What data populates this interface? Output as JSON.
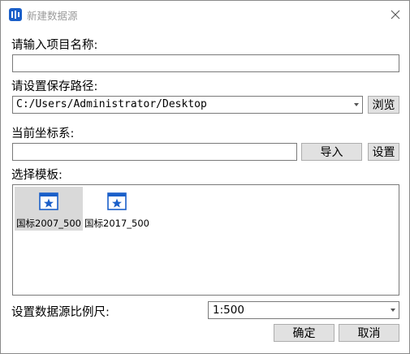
{
  "window": {
    "title": "新建数据源",
    "icon": "app-logo-icon",
    "close_icon": "close-icon"
  },
  "project_name": {
    "label": "请输入项目名称:",
    "value": ""
  },
  "save_path": {
    "label": "请设置保存路径:",
    "value": "C:/Users/Administrator/Desktop",
    "browse_label": "浏览"
  },
  "coordinate_system": {
    "label": "当前坐标系:",
    "value": "",
    "import_label": "导入",
    "settings_label": "设置"
  },
  "templates": {
    "label": "选择模板:",
    "items": [
      {
        "label": "国标2007_500",
        "selected": true,
        "icon": "template-icon"
      },
      {
        "label": "国标2017_500",
        "selected": false,
        "icon": "template-icon"
      }
    ]
  },
  "scale": {
    "label": "设置数据源比例尺:",
    "value": "1:500"
  },
  "footer": {
    "ok_label": "确定",
    "cancel_label": "取消"
  },
  "colors": {
    "icon_blue": "#1a5fc9",
    "selection_gray": "#d9d9d9",
    "button_face": "#e1e1e1"
  }
}
